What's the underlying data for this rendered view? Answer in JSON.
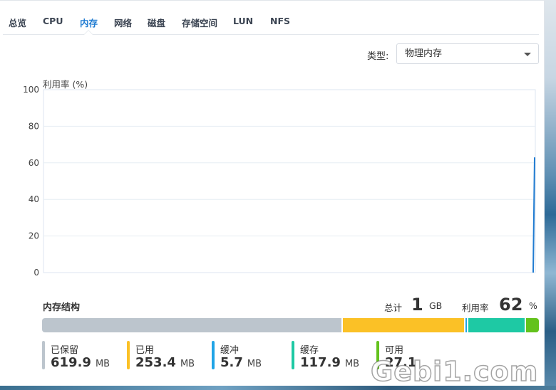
{
  "tabs": [
    {
      "label": "总览",
      "active": false
    },
    {
      "label": "CPU",
      "active": false
    },
    {
      "label": "内存",
      "active": true
    },
    {
      "label": "网络",
      "active": false
    },
    {
      "label": "磁盘",
      "active": false
    },
    {
      "label": "存储空间",
      "active": false
    },
    {
      "label": "LUN",
      "active": false
    },
    {
      "label": "NFS",
      "active": false
    }
  ],
  "type_selector": {
    "label": "类型:",
    "value": "物理内存"
  },
  "chart": {
    "y_title": "利用率 (%)",
    "line_color": "#1f7bd1"
  },
  "chart_data": {
    "type": "line",
    "ylabel": "利用率 (%)",
    "ylim": [
      0,
      100
    ],
    "yticks": [
      "0",
      "20",
      "40",
      "60",
      "80",
      "100"
    ],
    "grid": true,
    "series": [
      {
        "values": [
          0,
          63
        ]
      }
    ]
  },
  "memory": {
    "title": "内存结构",
    "total_label": "总计",
    "total_value": "1",
    "total_unit": "GB",
    "usage_label": "利用率",
    "usage_value": "62",
    "usage_unit": "%",
    "segments": [
      {
        "label": "已保留",
        "value": "619.9",
        "unit": "MB",
        "amount": 619.9,
        "color": "#bcc5cd"
      },
      {
        "label": "已用",
        "value": "253.4",
        "unit": "MB",
        "amount": 253.4,
        "color": "#fbc126"
      },
      {
        "label": "缓冲",
        "value": "5.7",
        "unit": "MB",
        "amount": 5.7,
        "color": "#20a4e6"
      },
      {
        "label": "缓存",
        "value": "117.9",
        "unit": "MB",
        "amount": 117.9,
        "color": "#1ec9a4"
      },
      {
        "label": "可用",
        "value": "27.1",
        "unit": "",
        "amount": 27.1,
        "color": "#63c21c"
      }
    ]
  },
  "watermark": "Gebi1.com"
}
